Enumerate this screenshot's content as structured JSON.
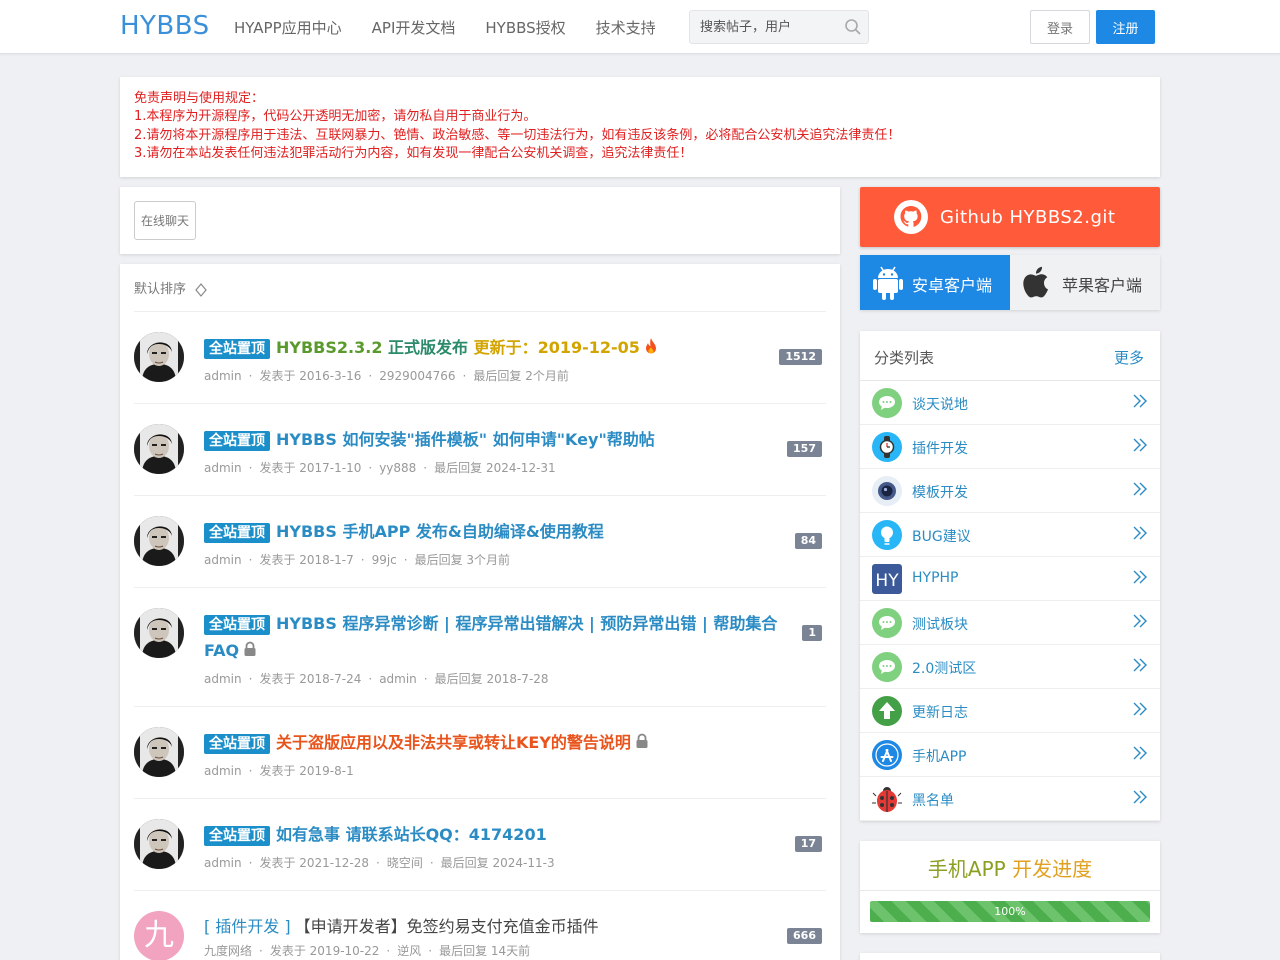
{
  "header": {
    "logo": "HYBBS",
    "nav": [
      "HYAPP应用中心",
      "API开发文档",
      "HYBBS授权",
      "技术支持"
    ],
    "search_placeholder": "搜索帖子，用户",
    "login": "登录",
    "register": "注册"
  },
  "notice": {
    "lines": [
      "免责声明与使用规定：",
      "1.本程序为开源程序，代码公开透明无加密，请勿私自用于商业行为。",
      "2.请勿将本开源程序用于违法、互联网暴力、铯情、政治敏感、等一切违法行为，如有违反该条例，必将配合公安机关追究法律责任！",
      "3.请勿在本站发表任何违法犯罪活动行为内容，如有发现一律配合公安机关调查，追究法律责任！"
    ],
    "color": "#e02020"
  },
  "chat": {
    "button": "在线聊天"
  },
  "list": {
    "sort_label": "默认排序",
    "pin_badge": "全站置顶",
    "posts": [
      {
        "pinned": true,
        "title_parts": [
          {
            "text": "HYBBS2.3.2 ",
            "color": "#5a9a2c"
          },
          {
            "text": "正式版发布 ",
            "color": "#2a8a6a"
          },
          {
            "text": "更新于：2019-12-05",
            "color": "#d2a400"
          }
        ],
        "icon": "fire-icon",
        "author": "admin",
        "date": "发表于 2016-3-16",
        "last_user": "2929004766",
        "last_reply": "最后回复 2个月前",
        "replies": "1512",
        "avatar": "man"
      },
      {
        "pinned": true,
        "title_parts": [
          {
            "text": "HYBBS 如何安装\"插件模板\" 如何申请\"Key\"帮助帖",
            "color": "#2b8cc4"
          }
        ],
        "author": "admin",
        "date": "发表于 2017-1-10",
        "last_user": "yy888",
        "last_reply": "最后回复 2024-12-31",
        "replies": "157",
        "avatar": "man"
      },
      {
        "pinned": true,
        "title_parts": [
          {
            "text": "HYBBS 手机APP 发布&自助编译&使用教程",
            "color": "#2b8cc4"
          }
        ],
        "author": "admin",
        "date": "发表于 2018-1-7",
        "last_user": "99jc",
        "last_reply": "最后回复 3个月前",
        "replies": "84",
        "avatar": "man"
      },
      {
        "pinned": true,
        "title_parts": [
          {
            "text": "HYBBS 程序异常诊断 | 程序异常出错解决 | 预防异常出错 | 帮助集合FAQ",
            "color": "#2b8cc4"
          }
        ],
        "icon": "lock-icon",
        "author": "admin",
        "date": "发表于 2018-7-24",
        "last_user": "admin",
        "last_reply": "最后回复 2018-7-28",
        "replies": "1",
        "avatar": "man"
      },
      {
        "pinned": true,
        "title_parts": [
          {
            "text": "关于盗版应用以及非法共享或转让KEY的警告说明",
            "color": "#e8541c"
          }
        ],
        "icon": "lock-icon",
        "author": "admin",
        "date": "发表于 2019-8-1",
        "avatar": "man"
      },
      {
        "pinned": true,
        "title_parts": [
          {
            "text": "如有急事 请联系站长QQ：4174201",
            "color": "#2b8cc4"
          }
        ],
        "author": "admin",
        "date": "发表于 2021-12-28",
        "last_user": "晓空间",
        "last_reply": "最后回复 2024-11-3",
        "replies": "17",
        "avatar": "man"
      },
      {
        "pinned": false,
        "category": "[ 插件开发 ]",
        "title_parts": [
          {
            "text": "【申请开发者】免签约易支付充值金币插件",
            "color": "#444444"
          }
        ],
        "author": "九度网络",
        "date": "发表于 2019-10-22",
        "last_user": "逆风",
        "last_reply": "最后回复 14天前",
        "replies": "666",
        "avatar": "jiu",
        "avatar_char": "九"
      }
    ]
  },
  "sidebar": {
    "github": "Github HYBBS2.git",
    "android": "安卓客户端",
    "ios": "苹果客户端",
    "categories_title": "分类列表",
    "categories_more": "更多",
    "categories": [
      {
        "label": "谈天说地",
        "icon": "chat-bubble-icon"
      },
      {
        "label": "插件开发",
        "icon": "watch-icon"
      },
      {
        "label": "模板开发",
        "icon": "camera-lens-icon"
      },
      {
        "label": "BUG建议",
        "icon": "lightbulb-icon"
      },
      {
        "label": "HYPHP",
        "icon": "hy-logo-icon"
      },
      {
        "label": "测试板块",
        "icon": "chat-bubble-icon"
      },
      {
        "label": "2.0测试区",
        "icon": "chat-bubble-icon"
      },
      {
        "label": "更新日志",
        "icon": "arrow-up-icon"
      },
      {
        "label": "手机APP",
        "icon": "app-store-icon"
      },
      {
        "label": "黑名单",
        "icon": "ladybug-icon"
      }
    ],
    "progress_title_a": "手机APP ",
    "progress_title_b": "开发进度",
    "progress_value": 1.0,
    "progress_label": "100%"
  }
}
